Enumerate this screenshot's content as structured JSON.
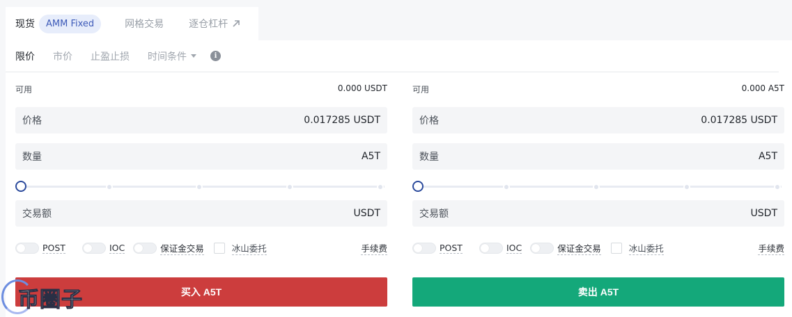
{
  "top_tabs": {
    "spot": "现货",
    "amm_badge": "AMM Fixed",
    "grid": "网格交易",
    "isolated_margin": "逐仓杠杆"
  },
  "order_types": {
    "limit": "限价",
    "market": "市价",
    "tp_sl": "止盈止损",
    "time_condition": "时间条件",
    "info": "i"
  },
  "buy": {
    "available_label": "可用",
    "available_value": "0.000 USDT",
    "price_label": "价格",
    "price_value": "0.017285 USDT",
    "qty_label": "数量",
    "qty_unit": "A5T",
    "total_label": "交易额",
    "total_unit": "USDT",
    "slider_percent": 0,
    "button": "买入 A5T"
  },
  "sell": {
    "available_label": "可用",
    "available_value": "0.000 A5T",
    "price_label": "价格",
    "price_value": "0.017285 USDT",
    "qty_label": "数量",
    "qty_unit": "A5T",
    "total_label": "交易额",
    "total_unit": "USDT",
    "slider_percent": 0,
    "button": "卖出 A5T"
  },
  "options": {
    "post": "POST",
    "ioc": "IOC",
    "margin_trade": "保证金交易",
    "iceberg": "冰山委托",
    "fee": "手续费"
  },
  "watermark": {
    "text": "币圈子"
  },
  "colors": {
    "buy": "#cc3d3d",
    "sell": "#14a87a",
    "accent": "#2b4a9c"
  }
}
